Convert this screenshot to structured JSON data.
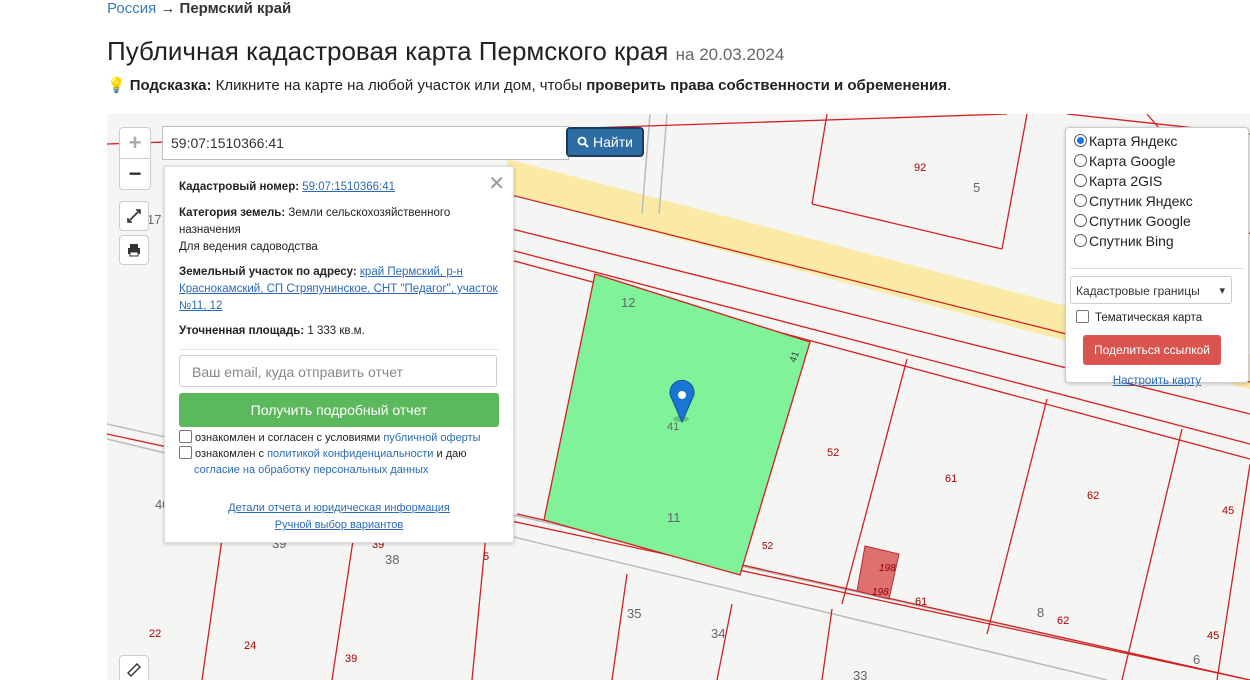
{
  "breadcrumb": {
    "root": "Россия",
    "arrow": "→",
    "current": "Пермский край"
  },
  "title": {
    "main": "Публичная кадастровая карта Пермского края",
    "date": "на 20.03.2024"
  },
  "hint": {
    "label": "Подсказка:",
    "text": "Кликните на карте на любой участок или дом, чтобы",
    "bold": "проверить права собственности и обременения",
    "end": "."
  },
  "search": {
    "value": "59:07:1510366:41",
    "button": "Найти"
  },
  "zoom": {
    "plus": "+",
    "minus": "−"
  },
  "popup": {
    "cad_label": "Кадастровый номер:",
    "cad_value": "59:07:1510366:41",
    "cat_label": "Категория земель:",
    "cat_value": "Земли сельскохозяйственного назначения",
    "use": "Для ведения садоводства",
    "addr_label": "Земельный участок по адресу:",
    "addr_value": "край Пермский, р-н Краснокамский, СП Стряпунинское, СНТ \"Педагог\", участок №11, 12",
    "area_label": "Уточненная площадь:",
    "area_value": "1 333 кв.м.",
    "email_placeholder": "Ваш email, куда отправить отчет",
    "report_button": "Получить подробный отчет",
    "agree1_text": "ознакомлен и согласен с условиями",
    "agree1_link": "публичной оферты",
    "agree2_text": "ознакомлен с",
    "agree2_link": "политикой конфиденциальности",
    "agree2_mid": "и даю",
    "agree2_link2": "согласие на обработку персональных данных",
    "details_link": "Детали отчета и юридическая информация",
    "manual_link": "Ручной выбор вариантов"
  },
  "layers": {
    "options": [
      "Карта Яндекс",
      "Карта Google",
      "Карта 2GIS",
      "Спутник Яндекс",
      "Спутник Google",
      "Спутник Bing"
    ],
    "selected": 0,
    "select_value": "Кадастровые границы",
    "thematic": "Тематическая карта",
    "share": "Поделиться ссылкой",
    "setup": "Настроить карту"
  },
  "map_labels": [
    "92",
    "5",
    "17",
    "12",
    "41",
    "41",
    "11",
    "52",
    "52",
    "61",
    "62",
    "45",
    "198",
    "198",
    "61",
    "8",
    "62",
    "45",
    "6",
    "40",
    "39",
    "39",
    "38",
    "5",
    "35",
    "34",
    "33",
    "22",
    "24",
    "39"
  ],
  "colors": {
    "parcel": "#7ff29a",
    "boundary": "#d42020",
    "building": "#e07070",
    "road": "#fbe9a6",
    "pin": "#1976d2"
  }
}
